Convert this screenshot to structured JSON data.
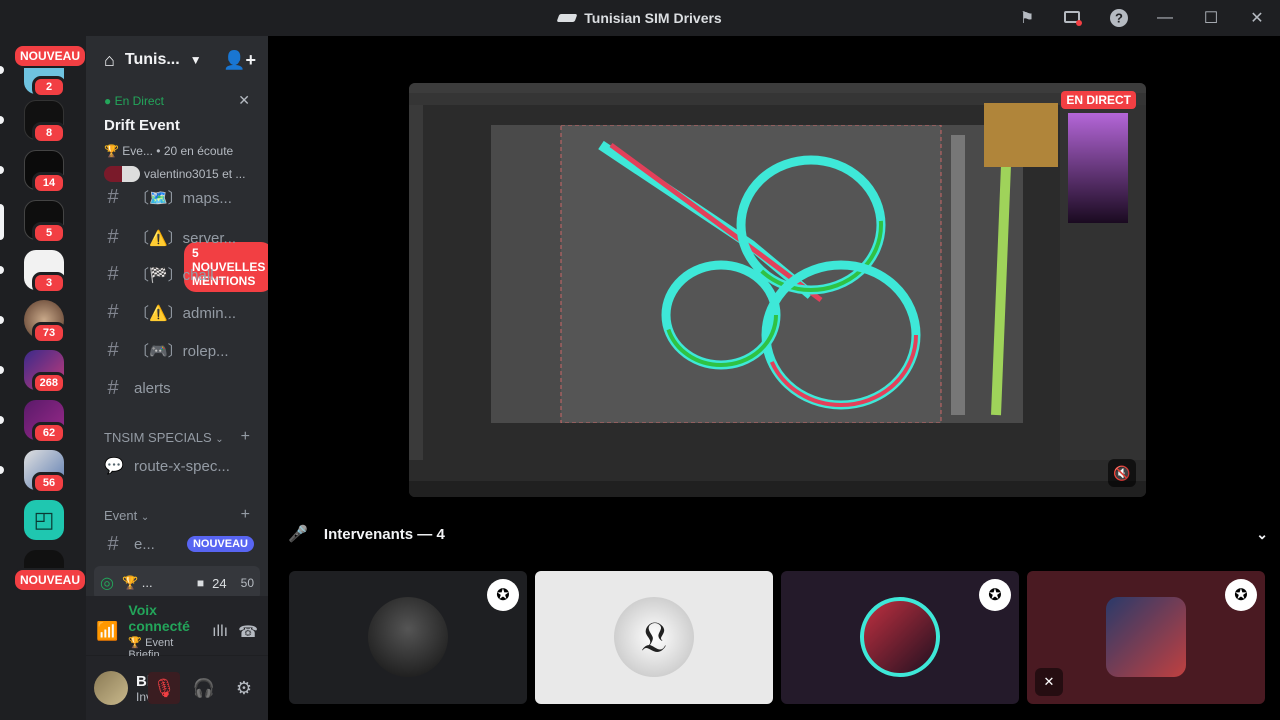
{
  "window": {
    "title": "Tunisian SIM Drivers"
  },
  "guilds": [
    {
      "badge": "2"
    },
    {
      "badge": "8"
    },
    {
      "badge": "14"
    },
    {
      "badge": "5"
    },
    {
      "badge": "3"
    },
    {
      "badge": "73"
    },
    {
      "badge": "268"
    },
    {
      "badge": "62"
    },
    {
      "badge": "56"
    },
    {
      "badge": ""
    }
  ],
  "nouveau_label": "NOUVEAU",
  "server": {
    "name": "Tunis..."
  },
  "live": {
    "status": "En Direct",
    "title": "Drift Event",
    "meta": "🏆 Eve... • 20 en écoute",
    "users": "valentino3015 et ..."
  },
  "mentions_label": "5 NOUVELLES MENTIONS",
  "channels": [
    {
      "icon": "#",
      "label": "〔🗺️〕maps..."
    },
    {
      "icon": "#",
      "label": "〔⚠️〕server..."
    },
    {
      "icon": "#",
      "label": "〔🏁〕chall..."
    },
    {
      "icon": "#",
      "label": "〔⚠️〕admin..."
    },
    {
      "icon": "#",
      "label": "〔🎮〕rolep..."
    },
    {
      "icon": "#",
      "label": "alerts"
    }
  ],
  "categories": {
    "specials": "TNSIM SPECIALS",
    "event": "Event"
  },
  "special_channel": "route-x-spec...",
  "event_channel": {
    "label": "e...",
    "badge": "NOUVEAU"
  },
  "stage_channel": {
    "label": "🏆 ...",
    "video_count": "24",
    "count": "50"
  },
  "voice": {
    "status": "Voix connecté",
    "channel": "🏆 Event Briefin..."
  },
  "user": {
    "name": "Blac...",
    "status": "Invisible"
  },
  "screen": {
    "live_badge": "EN DIRECT"
  },
  "speakers": {
    "label": "Intervenants — 4"
  },
  "colors": {
    "red": "#f23f43",
    "green": "#23a55a",
    "blurple": "#5865f2"
  }
}
